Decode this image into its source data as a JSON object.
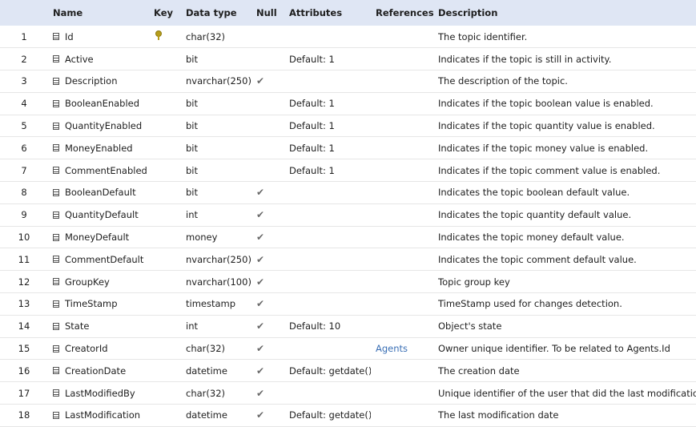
{
  "headers": {
    "num": "",
    "name": "Name",
    "key": "Key",
    "type": "Data type",
    "null": "Null",
    "attributes": "Attributes",
    "references": "References",
    "description": "Description"
  },
  "rows": [
    {
      "num": "1",
      "name": "Id",
      "key": true,
      "type": "char(32)",
      "null": "",
      "attributes": "",
      "references": "",
      "description": "The topic identifier."
    },
    {
      "num": "2",
      "name": "Active",
      "key": false,
      "type": "bit",
      "null": "",
      "attributes": "Default: 1",
      "references": "",
      "description": "Indicates if the topic is still in activity."
    },
    {
      "num": "3",
      "name": "Description",
      "key": false,
      "type": "nvarchar(250)",
      "null": "✔",
      "attributes": "",
      "references": "",
      "description": "The description of the topic."
    },
    {
      "num": "4",
      "name": "BooleanEnabled",
      "key": false,
      "type": "bit",
      "null": "",
      "attributes": "Default: 1",
      "references": "",
      "description": "Indicates if the topic boolean value is enabled."
    },
    {
      "num": "5",
      "name": "QuantityEnabled",
      "key": false,
      "type": "bit",
      "null": "",
      "attributes": "Default: 1",
      "references": "",
      "description": "Indicates if the topic quantity value is enabled."
    },
    {
      "num": "6",
      "name": "MoneyEnabled",
      "key": false,
      "type": "bit",
      "null": "",
      "attributes": "Default: 1",
      "references": "",
      "description": "Indicates if the topic money value is enabled."
    },
    {
      "num": "7",
      "name": "CommentEnabled",
      "key": false,
      "type": "bit",
      "null": "",
      "attributes": "Default: 1",
      "references": "",
      "description": "Indicates if the topic comment value is enabled."
    },
    {
      "num": "8",
      "name": "BooleanDefault",
      "key": false,
      "type": "bit",
      "null": "✔",
      "attributes": "",
      "references": "",
      "description": "Indicates the topic boolean default value."
    },
    {
      "num": "9",
      "name": "QuantityDefault",
      "key": false,
      "type": "int",
      "null": "✔",
      "attributes": "",
      "references": "",
      "description": "Indicates the topic quantity default value."
    },
    {
      "num": "10",
      "name": "MoneyDefault",
      "key": false,
      "type": "money",
      "null": "✔",
      "attributes": "",
      "references": "",
      "description": "Indicates the topic money default value."
    },
    {
      "num": "11",
      "name": "CommentDefault",
      "key": false,
      "type": "nvarchar(250)",
      "null": "✔",
      "attributes": "",
      "references": "",
      "description": "Indicates the topic comment default value."
    },
    {
      "num": "12",
      "name": "GroupKey",
      "key": false,
      "type": "nvarchar(100)",
      "null": "✔",
      "attributes": "",
      "references": "",
      "description": "Topic group key"
    },
    {
      "num": "13",
      "name": "TimeStamp",
      "key": false,
      "type": "timestamp",
      "null": "✔",
      "attributes": "",
      "references": "",
      "description": "TimeStamp used for changes detection."
    },
    {
      "num": "14",
      "name": "State",
      "key": false,
      "type": "int",
      "null": "✔",
      "attributes": "Default: 10",
      "references": "",
      "description": "Object's state"
    },
    {
      "num": "15",
      "name": "CreatorId",
      "key": false,
      "type": "char(32)",
      "null": "✔",
      "attributes": "",
      "references": "Agents",
      "description": "Owner unique identifier. To be related to Agents.Id"
    },
    {
      "num": "16",
      "name": "CreationDate",
      "key": false,
      "type": "datetime",
      "null": "✔",
      "attributes": "Default: getdate()",
      "references": "",
      "description": "The creation date"
    },
    {
      "num": "17",
      "name": "LastModifiedBy",
      "key": false,
      "type": "char(32)",
      "null": "✔",
      "attributes": "",
      "references": "",
      "description": "Unique identifier of the user that did the last modifications"
    },
    {
      "num": "18",
      "name": "LastModification",
      "key": false,
      "type": "datetime",
      "null": "✔",
      "attributes": "Default: getdate()",
      "references": "",
      "description": "The last modification date"
    }
  ]
}
